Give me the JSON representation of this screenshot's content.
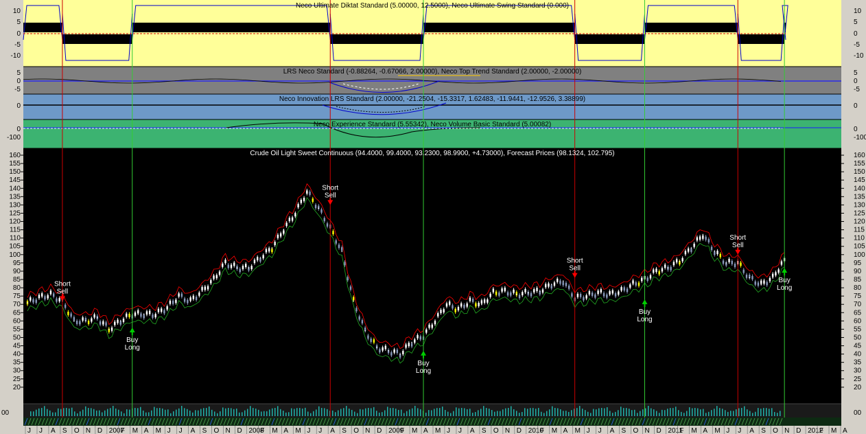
{
  "panels": {
    "diktat": {
      "title": "Neco Ultimate Diktat Standard (5.00000, 12.5000), Neco Ultimate Swing Standard (0.000)",
      "ticks": [
        "10",
        "5",
        "0",
        "-5",
        "-10"
      ],
      "bg": "#ffff99"
    },
    "lrs": {
      "title": "LRS Neco Standard (-0.88264, -0.67066, 2.00000), Neco Top Trend Standard (2.00000, -2.00000)",
      "ticks": [
        "5",
        "0",
        "-5"
      ],
      "bg": "#808080"
    },
    "innovation": {
      "title": "Neco Innovation LRS Standard (2.00000, -21.2504, -15.3317, 1.62483, -11.9441, -12.9526, 3.38899)",
      "ticks": [
        "0"
      ],
      "bg": "#6e99c8"
    },
    "experience": {
      "title": "Neco Experience Standard (5.55342), Neco Volume Basic Standard (5.00082)",
      "ticks": [
        "0",
        "-100"
      ],
      "bg": "#3cb371"
    },
    "price": {
      "title": "Crude Oil Light Sweet Continuous (94.4000, 99.4000, 93.2300, 98.9900, +4.73000), Forecast Prices (98.1324, 102.795)",
      "bg": "#000000"
    },
    "volume": {
      "label": "00"
    }
  },
  "x_axis_labels": [
    "J",
    "J",
    "A",
    "S",
    "O",
    "N",
    "D",
    "2007",
    "F",
    "M",
    "A",
    "M",
    "J",
    "J",
    "A",
    "S",
    "O",
    "N",
    "D",
    "2008",
    "F",
    "M",
    "A",
    "M",
    "J",
    "J",
    "A",
    "S",
    "O",
    "N",
    "D",
    "2009",
    "F",
    "M",
    "A",
    "M",
    "J",
    "J",
    "A",
    "S",
    "O",
    "N",
    "D",
    "2010",
    "F",
    "M",
    "A",
    "M",
    "J",
    "J",
    "A",
    "S",
    "O",
    "N",
    "D",
    "2011",
    "F",
    "M",
    "A",
    "M",
    "J",
    "J",
    "A",
    "S",
    "O",
    "N",
    "D",
    "2012",
    "F",
    "M",
    "A"
  ],
  "signals": [
    {
      "type": "short",
      "line1": "Short",
      "line2": "Sell",
      "date": "2006-09",
      "price": 72
    },
    {
      "type": "long",
      "line1": "Buy",
      "line2": "Long",
      "date": "2007-03",
      "price": 56
    },
    {
      "type": "short",
      "line1": "Short",
      "line2": "Sell",
      "date": "2008-08",
      "price": 130
    },
    {
      "type": "long",
      "line1": "Buy",
      "line2": "Long",
      "date": "2009-04",
      "price": 42
    },
    {
      "type": "short",
      "line1": "Short",
      "line2": "Sell",
      "date": "2010-05",
      "price": 86
    },
    {
      "type": "long",
      "line1": "Buy",
      "line2": "Long",
      "date": "2010-11",
      "price": 73
    },
    {
      "type": "short",
      "line1": "Short",
      "line2": "Sell",
      "date": "2011-07",
      "price": 100
    },
    {
      "type": "long",
      "line1": "Buy",
      "line2": "Long",
      "date": "2011-11",
      "price": 92
    }
  ],
  "colors": {
    "short": "#ff0000",
    "long": "#00cc00",
    "short_line": "#cc0000",
    "long_line": "#33cc33"
  },
  "chart_data": {
    "type": "line",
    "title": "Crude Oil Light Sweet Continuous (94.4000, 99.4000, 93.2300, 98.9900, +4.73000), Forecast Prices (98.1324, 102.795)",
    "ylim": [
      10,
      160
    ],
    "y_ticks": [
      20,
      25,
      30,
      35,
      40,
      45,
      50,
      55,
      60,
      65,
      70,
      75,
      80,
      85,
      90,
      95,
      100,
      105,
      110,
      115,
      120,
      125,
      130,
      135,
      140,
      145,
      150,
      155,
      160
    ],
    "series": [
      {
        "name": "Crude Oil Light Sweet Continuous",
        "x": [
          "2006-06",
          "2006-07",
          "2006-08",
          "2006-09",
          "2006-10",
          "2006-11",
          "2006-12",
          "2007-01",
          "2007-02",
          "2007-03",
          "2007-04",
          "2007-05",
          "2007-06",
          "2007-07",
          "2007-08",
          "2007-09",
          "2007-10",
          "2007-11",
          "2007-12",
          "2008-01",
          "2008-02",
          "2008-03",
          "2008-04",
          "2008-05",
          "2008-06",
          "2008-07",
          "2008-08",
          "2008-09",
          "2008-10",
          "2008-11",
          "2008-12",
          "2009-01",
          "2009-02",
          "2009-03",
          "2009-04",
          "2009-05",
          "2009-06",
          "2009-07",
          "2009-08",
          "2009-09",
          "2009-10",
          "2009-11",
          "2009-12",
          "2010-01",
          "2010-02",
          "2010-03",
          "2010-04",
          "2010-05",
          "2010-06",
          "2010-07",
          "2010-08",
          "2010-09",
          "2010-10",
          "2010-11",
          "2010-12",
          "2011-01",
          "2011-02",
          "2011-03",
          "2011-04",
          "2011-05",
          "2011-06",
          "2011-07",
          "2011-08",
          "2011-09",
          "2011-10",
          "2011-11"
        ],
        "values": [
          71,
          74,
          76,
          72,
          60,
          60,
          62,
          55,
          60,
          64,
          64,
          64,
          68,
          75,
          72,
          78,
          85,
          95,
          92,
          92,
          98,
          104,
          115,
          125,
          138,
          128,
          116,
          102,
          72,
          54,
          44,
          42,
          40,
          47,
          51,
          60,
          70,
          67,
          72,
          70,
          77,
          78,
          76,
          77,
          78,
          82,
          84,
          74,
          75,
          77,
          76,
          78,
          82,
          85,
          90,
          92,
          96,
          104,
          112,
          102,
          95,
          95,
          86,
          82,
          86,
          97
        ]
      }
    ]
  }
}
